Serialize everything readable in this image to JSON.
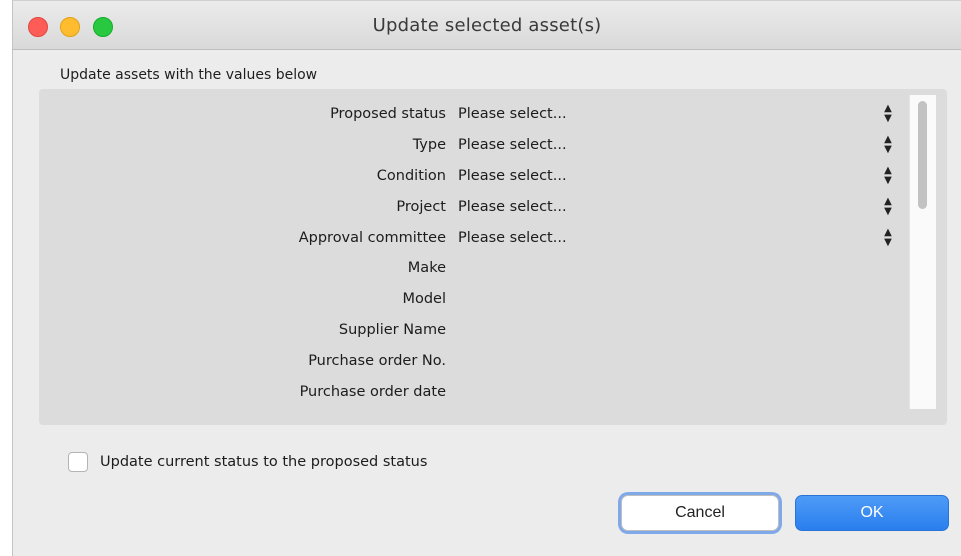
{
  "window": {
    "title": "Update selected asset(s)"
  },
  "form": {
    "section_label": "Update assets with the values below",
    "fields": [
      {
        "label": "Proposed status",
        "value": "Please select..."
      },
      {
        "label": "Type",
        "value": "Please select..."
      },
      {
        "label": "Condition",
        "value": "Please select..."
      },
      {
        "label": "Project",
        "value": "Please select..."
      },
      {
        "label": "Approval committee",
        "value": "Please select..."
      },
      {
        "label": "Make",
        "value": ""
      },
      {
        "label": "Model",
        "value": ""
      },
      {
        "label": "Supplier Name",
        "value": ""
      },
      {
        "label": "Purchase order No.",
        "value": ""
      },
      {
        "label": "Purchase order date",
        "value": ""
      }
    ],
    "checkbox_label": "Update current status to the proposed status",
    "checkbox_checked": false
  },
  "buttons": {
    "cancel_label": "Cancel",
    "ok_label": "OK"
  },
  "colors": {
    "ok_button": "#2a7fee",
    "focus_ring": "#7fa9e8",
    "close": "#fd5d56",
    "minimize": "#febc2e",
    "zoom": "#28c840"
  }
}
